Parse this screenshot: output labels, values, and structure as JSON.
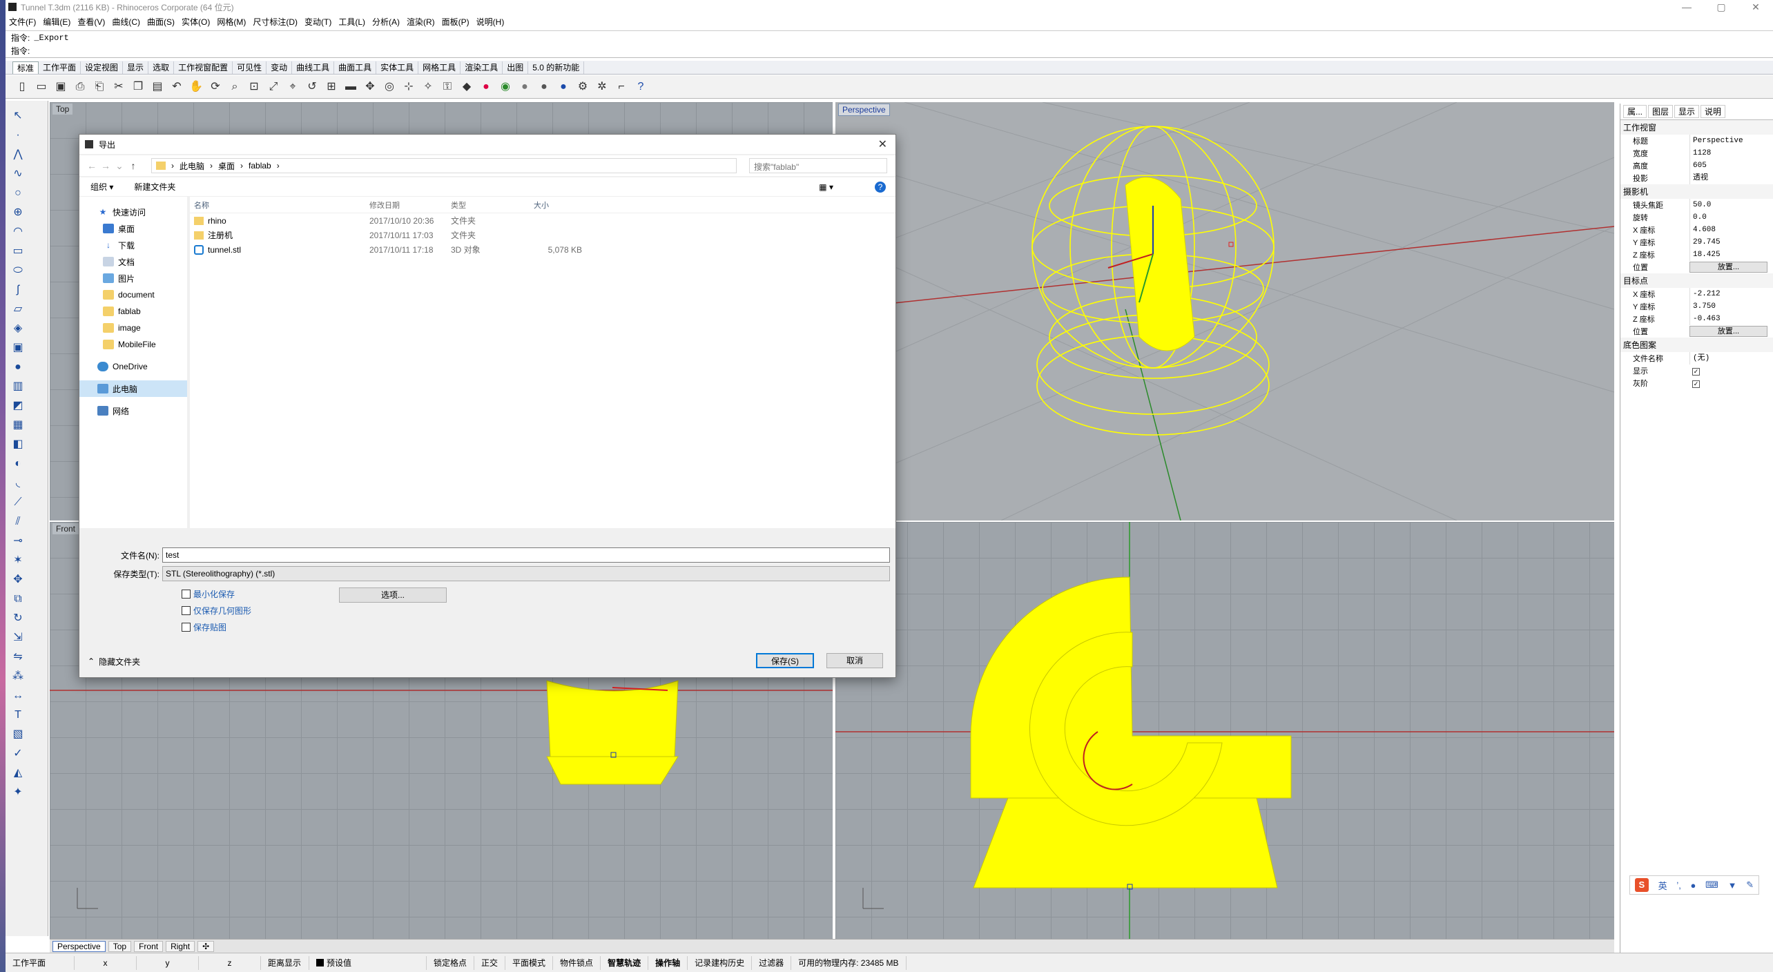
{
  "window": {
    "title": "Tunnel T.3dm (2116 KB) - Rhinoceros Corporate (64 位元)",
    "controls": [
      "—",
      "▢",
      "✕"
    ]
  },
  "menu": [
    "文件(F)",
    "编辑(E)",
    "查看(V)",
    "曲线(C)",
    "曲面(S)",
    "实体(O)",
    "网格(M)",
    "尺寸标注(D)",
    "变动(T)",
    "工具(L)",
    "分析(A)",
    "渲染(R)",
    "面板(P)",
    "说明(H)"
  ],
  "command": {
    "line1_label": "指令:",
    "line1_value": "_Export",
    "line2_label": "指令:",
    "line2_value": ""
  },
  "tabs": [
    "标准",
    "工作平面",
    "设定视图",
    "显示",
    "选取",
    "工作视窗配置",
    "可见性",
    "变动",
    "曲线工具",
    "曲面工具",
    "实体工具",
    "网格工具",
    "渲染工具",
    "出图",
    "5.0 的新功能"
  ],
  "viewports": {
    "top": "Top",
    "front": "Front",
    "perspective": "Perspective",
    "right": "Right"
  },
  "viewtabs": [
    "Perspective",
    "Top",
    "Front",
    "Right",
    "✣"
  ],
  "status": {
    "cplane": "工作平面",
    "x": "x",
    "y": "y",
    "z": "z",
    "distance": "距离显示",
    "default": "预设值",
    "items": [
      "锁定格点",
      "正交",
      "平面模式",
      "物件锁点",
      "智慧轨迹",
      "操作轴",
      "记录建构历史",
      "过滤器",
      "可用的物理内存: 23485 MB"
    ]
  },
  "props": {
    "tabs": [
      "属...",
      "图层",
      "显示",
      "说明"
    ],
    "viewport": {
      "section": "工作视窗",
      "title_k": "标题",
      "title_v": "Perspective",
      "width_k": "宽度",
      "width_v": "1128",
      "height_k": "高度",
      "height_v": "605",
      "proj_k": "投影",
      "proj_v": "透视"
    },
    "camera": {
      "section": "摄影机",
      "lens_k": "镜头焦距",
      "lens_v": "50.0",
      "rot_k": "旋转",
      "rot_v": "0.0",
      "x_k": "X 座标",
      "x_v": "4.608",
      "y_k": "Y 座标",
      "y_v": "29.745",
      "z_k": "Z 座标",
      "z_v": "18.425",
      "pos_k": "位置",
      "pos_btn": "放置..."
    },
    "target": {
      "section": "目标点",
      "x_k": "X 座标",
      "x_v": "-2.212",
      "y_k": "Y 座标",
      "y_v": "3.750",
      "z_k": "Z 座标",
      "z_v": "-0.463",
      "pos_k": "位置",
      "pos_btn": "放置..."
    },
    "wallpaper": {
      "section": "底色图案",
      "file_k": "文件名称",
      "file_v": "(无)",
      "show_k": "显示",
      "gray_k": "灰阶"
    }
  },
  "ime": {
    "logo": "S",
    "lang": "英"
  },
  "dialog": {
    "title": "导出",
    "path": [
      "此电脑",
      "桌面",
      "fablab"
    ],
    "search_placeholder": "搜索\"fablab\"",
    "organize": "组织 ▾",
    "newfolder": "新建文件夹",
    "nav": [
      {
        "label": "快速访问",
        "sub": false,
        "icon": "star-icon"
      },
      {
        "label": "桌面",
        "sub": true,
        "icon": "desktop-icon"
      },
      {
        "label": "下载",
        "sub": true,
        "icon": "download-icon"
      },
      {
        "label": "文档",
        "sub": true,
        "icon": "document-icon"
      },
      {
        "label": "图片",
        "sub": true,
        "icon": "picture-icon"
      },
      {
        "label": "document",
        "sub": true,
        "icon": "folder-icon"
      },
      {
        "label": "fablab",
        "sub": true,
        "icon": "folder-icon"
      },
      {
        "label": "image",
        "sub": true,
        "icon": "folder-icon"
      },
      {
        "label": "MobileFile",
        "sub": true,
        "icon": "folder-icon"
      },
      {
        "label": "OneDrive",
        "sub": false,
        "icon": "cloud-icon"
      },
      {
        "label": "此电脑",
        "sub": false,
        "icon": "computer-icon"
      },
      {
        "label": "网络",
        "sub": false,
        "icon": "network-icon"
      }
    ],
    "columns": [
      "名称",
      "修改日期",
      "类型",
      "大小"
    ],
    "files": [
      {
        "name": "rhino",
        "date": "2017/10/10 20:36",
        "type": "文件夹",
        "size": ""
      },
      {
        "name": "注册机",
        "date": "2017/10/11 17:03",
        "type": "文件夹",
        "size": ""
      },
      {
        "name": "tunnel.stl",
        "date": "2017/10/11 17:18",
        "type": "3D 对象",
        "size": "5,078 KB"
      }
    ],
    "filename_label": "文件名(N):",
    "filename": "test",
    "filetype_label": "保存类型(T):",
    "filetype": "STL (Stereolithography) (*.stl)",
    "options": [
      "最小化保存",
      "仅保存几何图形",
      "保存贴图"
    ],
    "options_btn": "选项...",
    "hide_folders": "隐藏文件夹",
    "save": "保存(S)",
    "cancel": "取消"
  }
}
